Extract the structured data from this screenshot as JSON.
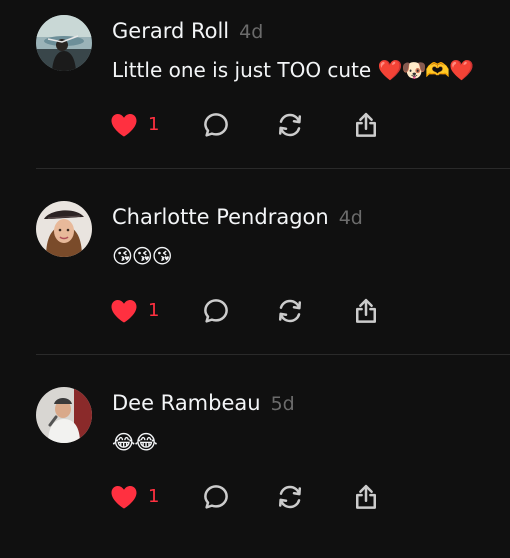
{
  "colors": {
    "background": "#101010",
    "text_primary": "#f3f5f7",
    "text_secondary": "#6b6b6b",
    "like_red": "#ff3040",
    "icon_gray": "#cccccc",
    "divider": "#2a2a2a"
  },
  "comments": [
    {
      "username": "Gerard Roll",
      "time": "4d",
      "text": "Little one is just TOO cute",
      "emoji": "❤️🐶🫶❤️",
      "likes": "1",
      "liked": true
    },
    {
      "username": "Charlotte Pendragon",
      "time": "4d",
      "text": "",
      "emoji": "😘😘😘",
      "likes": "1",
      "liked": true
    },
    {
      "username": "Dee Rambeau",
      "time": "5d",
      "text": "",
      "emoji": "😂😂",
      "likes": "1",
      "liked": true
    }
  ],
  "icons": {
    "like": "heart-filled-icon",
    "reply": "speech-bubble-icon",
    "repost": "repost-arrows-icon",
    "share": "share-upload-icon"
  }
}
